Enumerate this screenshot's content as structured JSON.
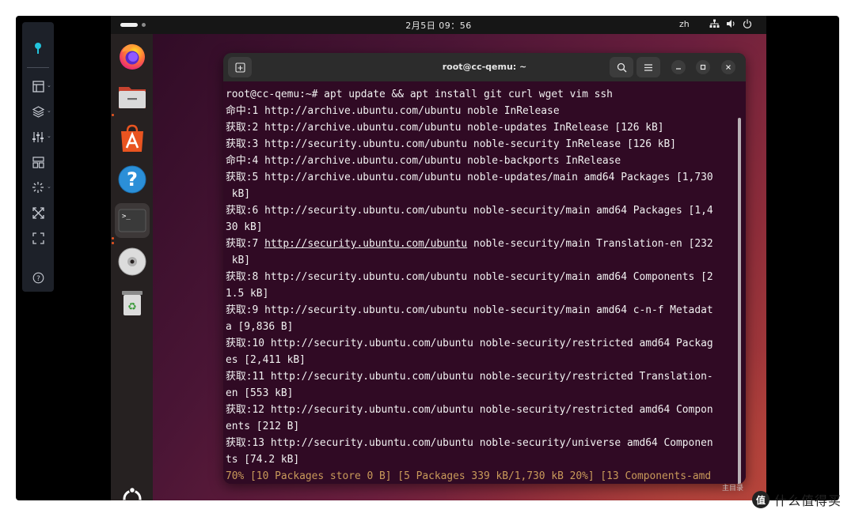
{
  "topbar": {
    "clock": "2月5日 09：56",
    "lang": "zh"
  },
  "terminal": {
    "title": "root@cc-qemu: ~",
    "lines": [
      "root@cc-qemu:~# apt update && apt install git curl wget vim ssh",
      "命中:1 http://archive.ubuntu.com/ubuntu noble InRelease",
      "获取:2 http://archive.ubuntu.com/ubuntu noble-updates InRelease [126 kB]",
      "获取:3 http://security.ubuntu.com/ubuntu noble-security InRelease [126 kB]",
      "命中:4 http://archive.ubuntu.com/ubuntu noble-backports InRelease",
      "获取:5 http://archive.ubuntu.com/ubuntu noble-updates/main amd64 Packages [1,730",
      " kB]",
      "获取:6 http://security.ubuntu.com/ubuntu noble-security/main amd64 Packages [1,4",
      "30 kB]",
      "获取:7 ",
      " kB]",
      "获取:8 http://security.ubuntu.com/ubuntu noble-security/main amd64 Components [2",
      "1.5 kB]",
      "获取:9 http://security.ubuntu.com/ubuntu noble-security/main amd64 c-n-f Metadat",
      "a [9,836 B]",
      "获取:10 http://security.ubuntu.com/ubuntu noble-security/restricted amd64 Packag",
      "es [2,411 kB]",
      "获取:11 http://security.ubuntu.com/ubuntu noble-security/restricted Translation-",
      "en [553 kB]",
      "获取:12 http://security.ubuntu.com/ubuntu noble-security/restricted amd64 Compon",
      "ents [212 B]",
      "获取:13 http://security.ubuntu.com/ubuntu noble-security/universe amd64 Componen",
      "ts [74.2 kB]",
      "70% [10 Packages store 0 B] [5 Packages 339 kB/1,730 kB 20%] [13 Components-amd"
    ],
    "line7_link": "http://security.ubuntu.com/ubuntu",
    "line7_rest": " noble-security/main Translation-en [232"
  },
  "desktop": {
    "label": "主目录"
  },
  "watermark": {
    "logo": "值",
    "text": "什么值得买"
  },
  "colors": {
    "terminal_bg": "#300a24",
    "ubuntu_orange": "#e95420",
    "progress_text": "#c99a5a"
  },
  "icons": {
    "vm_toolbar": [
      "pin-icon",
      "window-layout-icon",
      "layers-icon",
      "sliders-icon",
      "dashboard-icon",
      "loading-icon",
      "expand-icon",
      "fullscreen-icon",
      "help-icon"
    ],
    "dock": [
      "firefox-icon",
      "files-icon",
      "app-center-icon",
      "help-icon",
      "terminal-icon",
      "disc-icon",
      "trash-icon",
      "ubuntu-logo-icon"
    ]
  }
}
